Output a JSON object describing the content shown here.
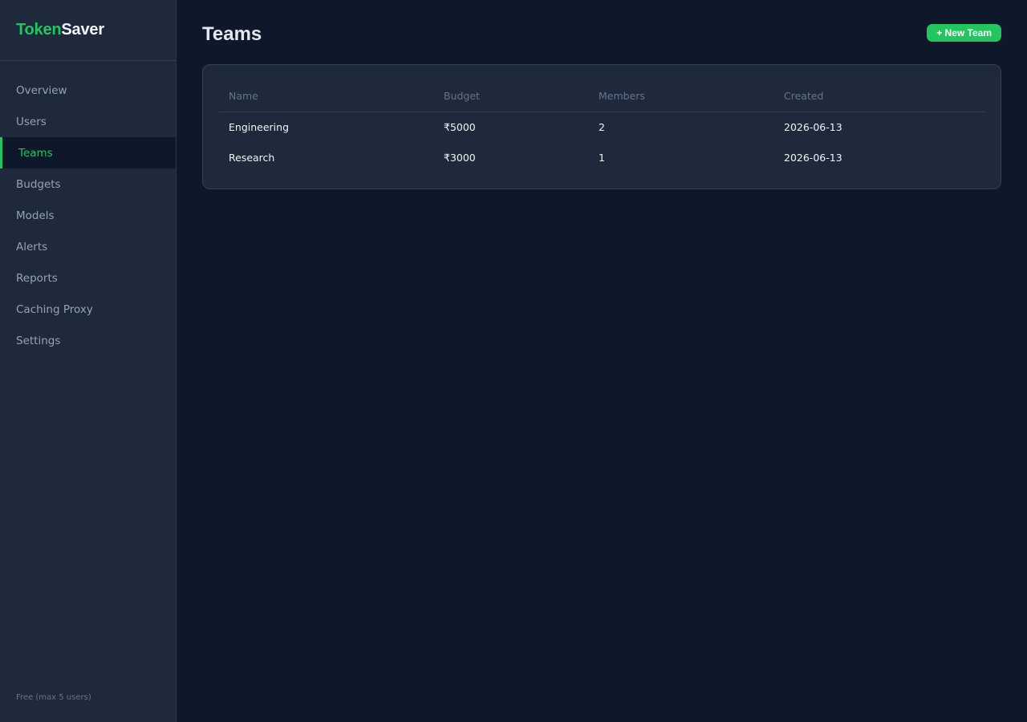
{
  "brand": {
    "part1": "Token",
    "part2": "Saver"
  },
  "sidebar": {
    "items": [
      {
        "label": "Overview",
        "active": false
      },
      {
        "label": "Users",
        "active": false
      },
      {
        "label": "Teams",
        "active": true
      },
      {
        "label": "Budgets",
        "active": false
      },
      {
        "label": "Models",
        "active": false
      },
      {
        "label": "Alerts",
        "active": false
      },
      {
        "label": "Reports",
        "active": false
      },
      {
        "label": "Caching Proxy",
        "active": false
      },
      {
        "label": "Settings",
        "active": false
      }
    ],
    "plan_note": "Free (max 5 users)"
  },
  "header": {
    "title": "Teams",
    "new_button_label": "+ New Team"
  },
  "table": {
    "columns": [
      "Name",
      "Budget",
      "Members",
      "Created"
    ],
    "rows": [
      [
        "Engineering",
        "₹5000",
        "2",
        "2026-06-13"
      ],
      [
        "Research",
        "₹3000",
        "1",
        "2026-06-13"
      ]
    ]
  },
  "colors": {
    "accent": "#22c55e",
    "background": "#0f172a",
    "surface": "#1e293b"
  }
}
